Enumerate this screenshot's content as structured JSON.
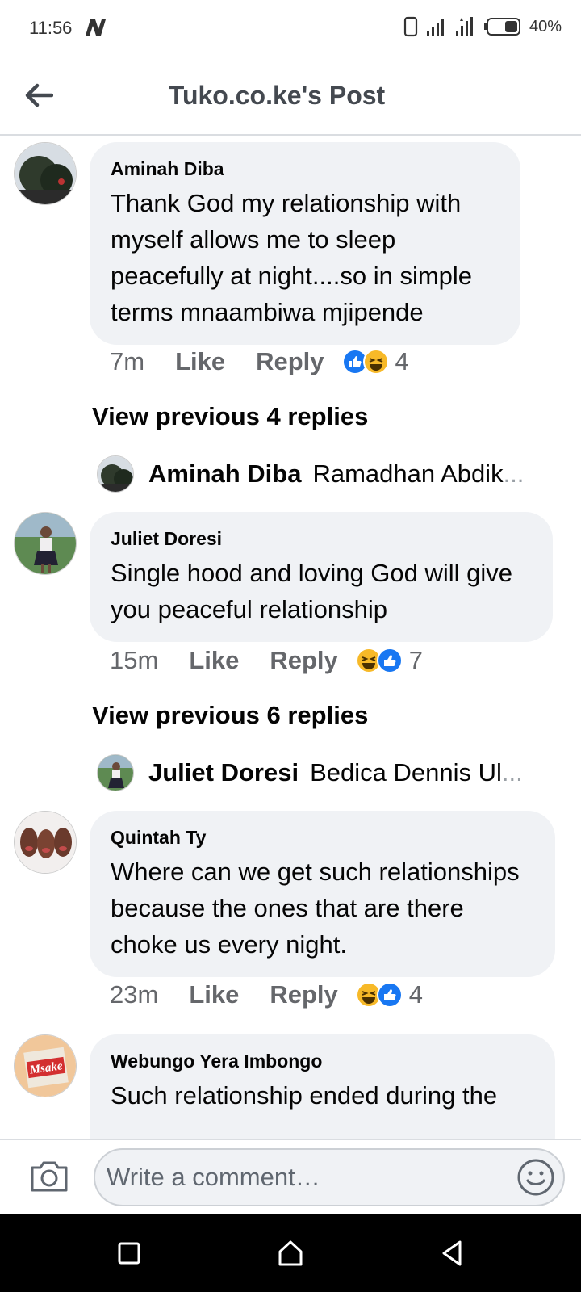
{
  "status_bar": {
    "time": "11:56",
    "battery": "40%"
  },
  "header": {
    "title": "Tuko.co.ke's Post"
  },
  "comments": [
    {
      "name": "Aminah Diba",
      "text": "Thank God my relationship with myself allows me to sleep peacefully at night....so in simple terms mnaambiwa mjipende",
      "time": "7m",
      "like_label": "Like",
      "reply_label": "Reply",
      "reaction_count": "4",
      "view_previous": "View previous 4 replies",
      "latest_reply": {
        "name": "Aminah Diba",
        "snippet": "Ramadhan Abdik",
        "ellipsis": "..."
      }
    },
    {
      "name": "Juliet Doresi",
      "text": "Single hood and loving God will give you peaceful relationship",
      "time": "15m",
      "like_label": "Like",
      "reply_label": "Reply",
      "reaction_count": "7",
      "view_previous": "View previous 6 replies",
      "latest_reply": {
        "name": "Juliet Doresi",
        "snippet": "Bedica Dennis Ul",
        "ellipsis": "..."
      }
    },
    {
      "name": "Quintah Ty",
      "text": "Where can we get such relationships because the ones that are there choke us every night.",
      "time": "23m",
      "like_label": "Like",
      "reply_label": "Reply",
      "reaction_count": "4"
    },
    {
      "name": "Webungo Yera Imbongo",
      "text": "Such relationship ended during the",
      "avatar_text": "Msake"
    }
  ],
  "composer": {
    "placeholder": "Write a comment…"
  },
  "colors": {
    "like_blue": "#1877f2",
    "haha_yellow": "#f7b928",
    "bubble_bg": "#f0f2f5",
    "meta_gray": "#65676b"
  }
}
